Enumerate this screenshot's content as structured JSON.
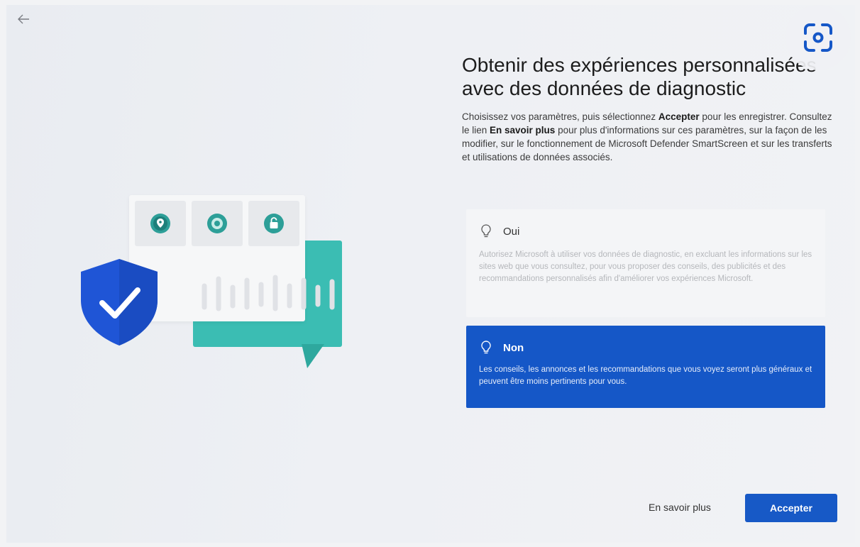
{
  "header": {
    "title": "Obtenir des expériences personnalisées avec des données de diagnostic"
  },
  "description": {
    "part1": "Choisissez vos paramètres, puis sélectionnez ",
    "accept_word": "Accepter",
    "part2": " pour les enregistrer. Consultez le lien ",
    "learn_word": "En savoir plus",
    "part3": " pour plus d'informations sur ces paramètres, sur la façon de les modifier, sur le fonctionnement de Microsoft Defender SmartScreen et sur les transferts et utilisations de données associés."
  },
  "options": [
    {
      "label": "Oui",
      "text": "Autorisez Microsoft à utiliser vos données de diagnostic, en excluant les informations sur les sites web que vous consultez, pour vous proposer des conseils, des publicités et des recommandations personnalisés afin d'améliorer vos expériences Microsoft.",
      "selected": false
    },
    {
      "label": "Non",
      "text": "Les conseils, les annonces et les recommandations que vous voyez seront plus généraux et peuvent être moins pertinents pour vous.",
      "selected": true
    }
  ],
  "footer": {
    "learn_more": "En savoir plus",
    "accept": "Accepter"
  },
  "icons": {
    "back": "back-arrow-icon",
    "lens": "screen-capture-lens-icon",
    "option": "lightbulb-icon",
    "illustration": [
      "location-pin-icon",
      "gear-icon",
      "padlock-icon",
      "shield-check-icon"
    ]
  },
  "colors": {
    "accent": "#1557c7",
    "teal": "#3bbdb3",
    "shield": "#1f55d6"
  }
}
